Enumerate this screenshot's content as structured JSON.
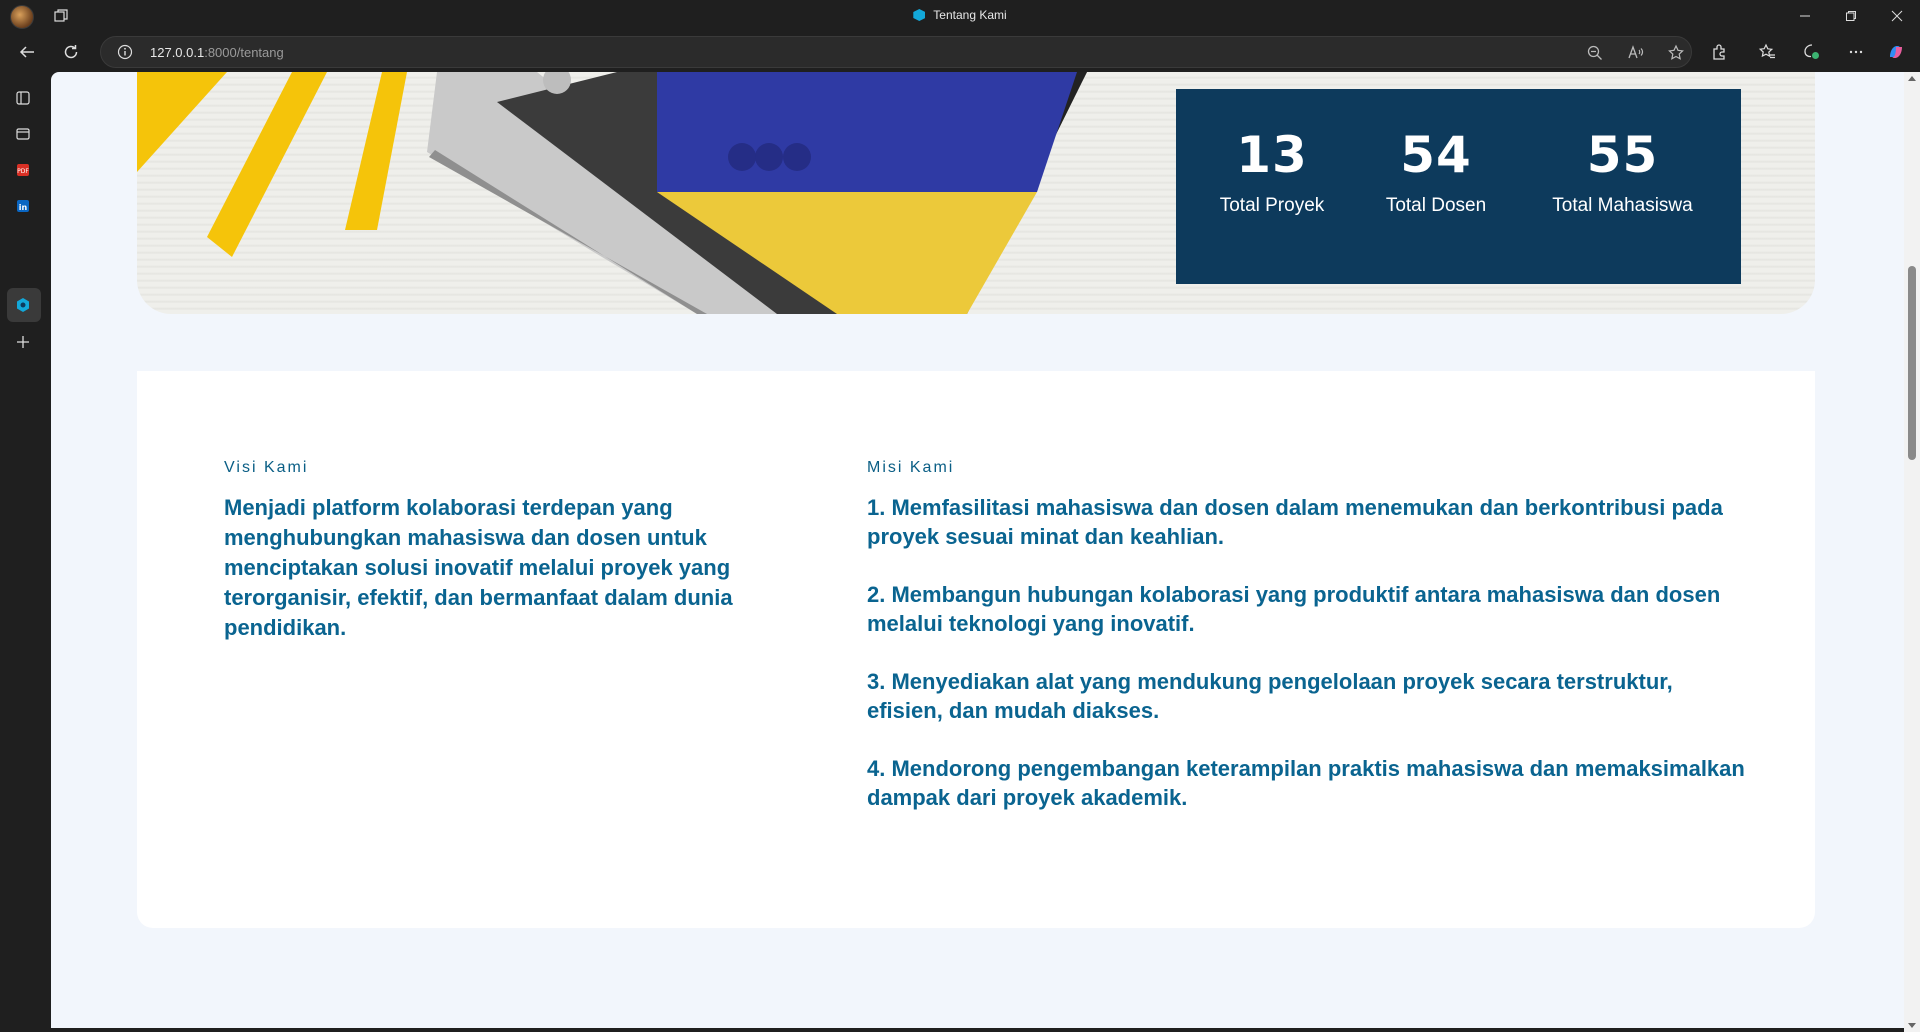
{
  "browser": {
    "tab_title": "Tentang Kami",
    "url_host": "127.0.0.1",
    "url_rest": ":8000/tentang"
  },
  "stats": [
    {
      "value": "13",
      "label": "Total Proyek"
    },
    {
      "value": "54",
      "label": "Total Dosen"
    },
    {
      "value": "55",
      "label": "Total Mahasiswa"
    }
  ],
  "visi": {
    "label": "Visi Kami",
    "text": "Menjadi platform kolaborasi terdepan yang menghubungkan mahasiswa dan dosen untuk menciptakan solusi inovatif melalui proyek yang terorganisir, efektif, dan bermanfaat dalam dunia pendidikan."
  },
  "misi": {
    "label": "Misi Kami",
    "items": [
      "1. Memfasilitasi mahasiswa dan dosen dalam menemukan dan berkontribusi pada proyek sesuai minat dan keahlian.",
      "2. Membangun hubungan kolaborasi yang produktif antara mahasiswa dan dosen melalui teknologi yang inovatif.",
      "3. Menyediakan alat yang mendukung pengelolaan proyek secara terstruktur, efisien, dan mudah diakses.",
      "4. Mendorong pengembangan keterampilan praktis mahasiswa dan memaksimalkan dampak dari proyek akademik."
    ]
  },
  "colors": {
    "stats_bg": "#0d3a5c",
    "accent_text": "#0a6490",
    "page_bg": "#f2f6fc"
  }
}
